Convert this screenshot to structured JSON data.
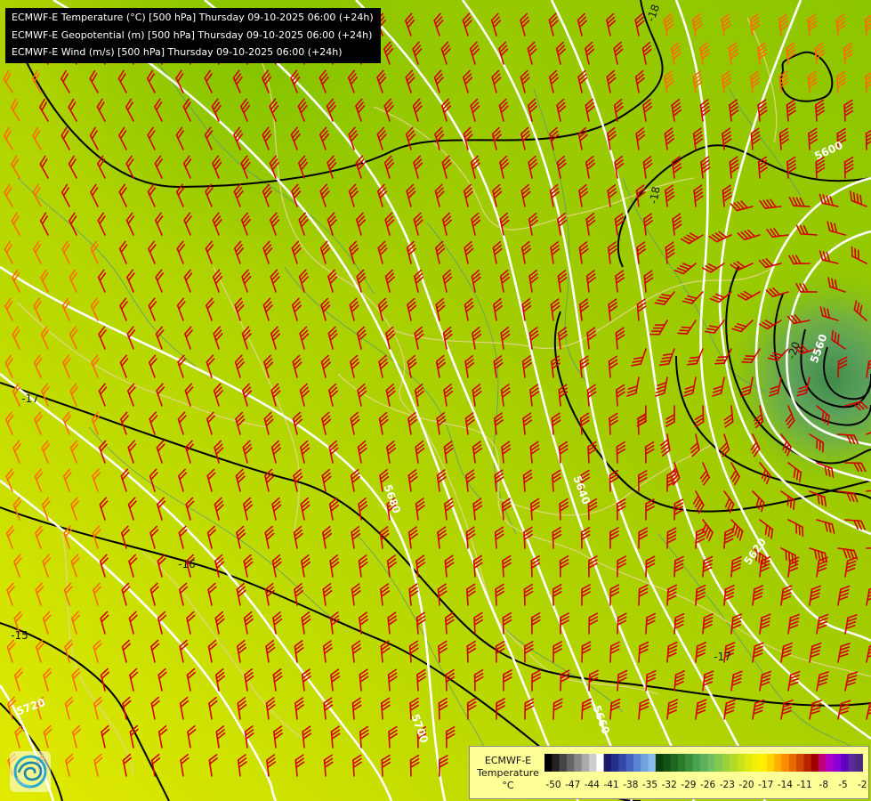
{
  "header": {
    "lines": [
      "ECMWF-E Temperature (°C) [500 hPa] Thursday 09-10-2025 06:00 (+24h)",
      "ECMWF-E Geopotential (m) [500 hPa] Thursday 09-10-2025 06:00 (+24h)",
      "ECMWF-E Wind (m/s) [500 hPa] Thursday 09-10-2025 06:00 (+24h)"
    ]
  },
  "map": {
    "contour_labels_geopotential": [
      "5600",
      "5620",
      "5640",
      "5660",
      "5680",
      "5700",
      "5720",
      "5560"
    ],
    "contour_labels_temperature": [
      "-18",
      "-18",
      "-17",
      "-16",
      "-15",
      "-17",
      "-20"
    ],
    "colors": {
      "geopotential_lines": "#ffffff",
      "isotherm_lines": "#000000",
      "wind_barbs": "#d40000",
      "wind_barbs_weak": "#ff6a00",
      "borders": "#e6d58a",
      "rivers": "#4c8c8c"
    }
  },
  "legend": {
    "title_lines": [
      "ECMWF-E",
      "Temperature",
      "°C"
    ],
    "ticks": [
      "-50",
      "-47",
      "-44",
      "-41",
      "-38",
      "-35",
      "-32",
      "-29",
      "-26",
      "-23",
      "-20",
      "-17",
      "-14",
      "-11",
      "-8",
      "-5",
      "-2"
    ],
    "swatches": [
      "#000000",
      "#222222",
      "#444444",
      "#666666",
      "#888888",
      "#aaaaaa",
      "#cccccc",
      "#ffffff",
      "#1a1a6a",
      "#25308a",
      "#3448a6",
      "#4662be",
      "#5a82d2",
      "#70a2e0",
      "#88bcec",
      "#0b3d0b",
      "#145214",
      "#1f661f",
      "#2c7a2c",
      "#3a8e3a",
      "#4aa24a",
      "#5cb05c",
      "#6fbf5f",
      "#84c94f",
      "#9ad23d",
      "#b0da2a",
      "#c6e21a",
      "#dcea10",
      "#f0f00a",
      "#fff000",
      "#ffd400",
      "#ffb000",
      "#ff8c00",
      "#e86a00",
      "#d04800",
      "#b82400",
      "#a00000",
      "#c0007a",
      "#b000c8",
      "#8a00d8",
      "#6000c0",
      "#5a2a9a",
      "#4a2a7a"
    ]
  },
  "logo": {
    "icon": "ecmwf-swirl-logo-icon"
  }
}
